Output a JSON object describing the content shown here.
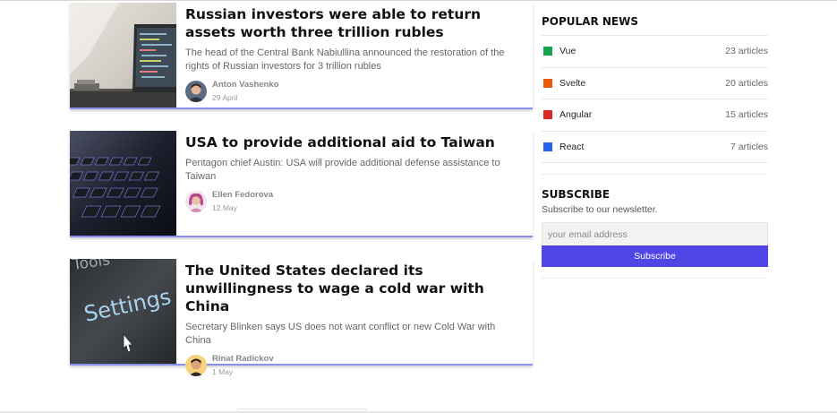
{
  "articles": [
    {
      "title": "Russian investors were able to return assets worth three trillion rubles",
      "excerpt": "The head of the Central Bank Nabiullina announced the restoration of the rights of Russian investors for 3 trillion rubles",
      "author": "Anton Vashenko",
      "date": "29 April",
      "image_icon": "laptop-photo"
    },
    {
      "title": "USA to provide additional aid to Taiwan",
      "excerpt": "Pentagon chief Austin: USA will provide additional defense assistance to Taiwan",
      "author": "Ellen Fedorova",
      "date": "12 May",
      "image_icon": "keyboard-photo"
    },
    {
      "title": "The United States declared its unwillingness to wage a cold war with China",
      "excerpt": "Secretary Blinken says US does not want conflict or new Cold War with China",
      "author": "Rinat Radickov",
      "date": "1 May",
      "image_icon": "settings-screen-photo",
      "image_text": {
        "top": "Tools",
        "main": "Settings"
      }
    }
  ],
  "sidebar": {
    "popular_title": "POPULAR NEWS",
    "categories": [
      {
        "name": "Vue",
        "count": "23 articles",
        "color": "#16a34a"
      },
      {
        "name": "Svelte",
        "count": "20 articles",
        "color": "#e8590c"
      },
      {
        "name": "Angular",
        "count": "15 articles",
        "color": "#dc2626"
      },
      {
        "name": "React",
        "count": "7 articles",
        "color": "#2563eb"
      }
    ],
    "subscribe_title": "SUBSCRIBE",
    "subscribe_desc": "Subscribe to our newsletter.",
    "email_placeholder": "your email address",
    "subscribe_button": "Subscribe"
  }
}
